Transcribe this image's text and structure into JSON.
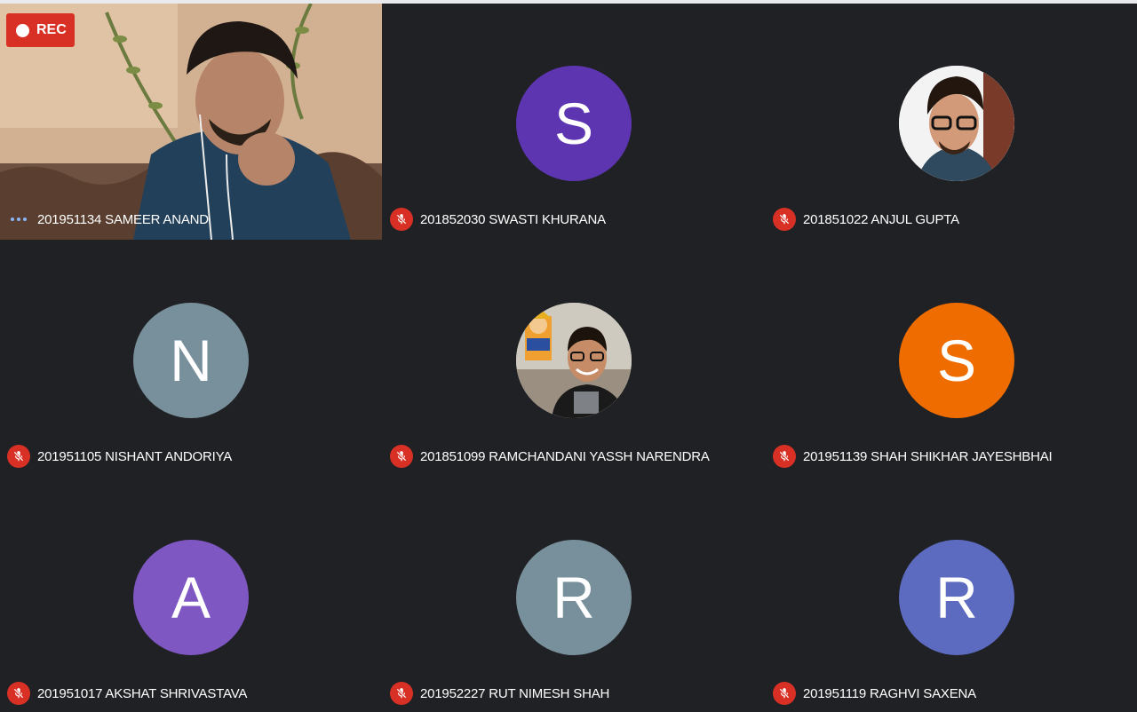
{
  "recording": {
    "label": "REC"
  },
  "participants": [
    {
      "name": "201951134 SAMEER ANAND",
      "type": "video",
      "status": "speaking"
    },
    {
      "name": "201852030 SWASTI KHURANA",
      "type": "initial",
      "initial": "S",
      "color": "#5e35b1",
      "status": "muted"
    },
    {
      "name": "201851022 ANJUL GUPTA",
      "type": "photo",
      "status": "muted"
    },
    {
      "name": "201951105 NISHANT ANDORIYA",
      "type": "initial",
      "initial": "N",
      "color": "#78909c",
      "status": "muted"
    },
    {
      "name": "201851099 RAMCHANDANI YASSH NARENDRA",
      "type": "photo",
      "status": "muted"
    },
    {
      "name": "201951139 SHAH SHIKHAR JAYESHBHAI",
      "type": "initial",
      "initial": "S",
      "color": "#ef6c00",
      "status": "muted"
    },
    {
      "name": "201951017 AKSHAT SHRIVASTAVA",
      "type": "initial",
      "initial": "A",
      "color": "#7e57c2",
      "status": "muted"
    },
    {
      "name": "201952227 RUT NIMESH SHAH",
      "type": "initial",
      "initial": "R",
      "color": "#78909c",
      "status": "muted"
    },
    {
      "name": "201951119 RAGHVI SAXENA",
      "type": "initial",
      "initial": "R",
      "color": "#5c6bc0",
      "status": "muted"
    }
  ],
  "colors": {
    "background": "#202124",
    "muted_badge": "#d93025",
    "speaking_dots": "#8ab4f8"
  },
  "icons": {
    "muted": "mic-off-icon",
    "speaking": "speaking-indicator-icon",
    "recording": "record-dot-icon"
  }
}
